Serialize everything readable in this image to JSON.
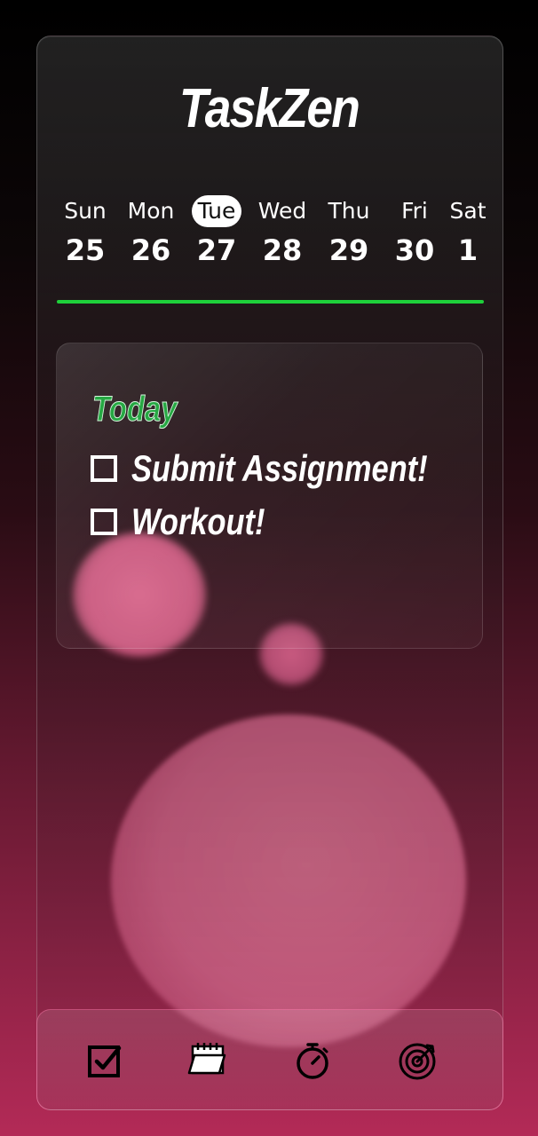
{
  "app": {
    "title": "TaskZen"
  },
  "week": {
    "selected_index": 2,
    "days": [
      {
        "name": "Sun",
        "date": "25"
      },
      {
        "name": "Mon",
        "date": "26"
      },
      {
        "name": "Tue",
        "date": "27"
      },
      {
        "name": "Wed",
        "date": "28"
      },
      {
        "name": "Thu",
        "date": "29"
      },
      {
        "name": "Fri",
        "date": "30"
      },
      {
        "name": "Sat",
        "date": "1"
      }
    ]
  },
  "today": {
    "heading": "Today",
    "tasks": [
      {
        "label": "Submit Assignment!",
        "checked": false
      },
      {
        "label": "Workout!",
        "checked": false
      }
    ]
  },
  "nav": {
    "items": [
      {
        "icon": "checkbox-tasks-icon"
      },
      {
        "icon": "calendar-icon"
      },
      {
        "icon": "stopwatch-icon"
      },
      {
        "icon": "target-icon"
      }
    ]
  },
  "colors": {
    "accent_green": "#1ed03a",
    "today_heading": "#26a843",
    "blob_pink": "#d8648a",
    "background_bottom": "#b32a57"
  }
}
